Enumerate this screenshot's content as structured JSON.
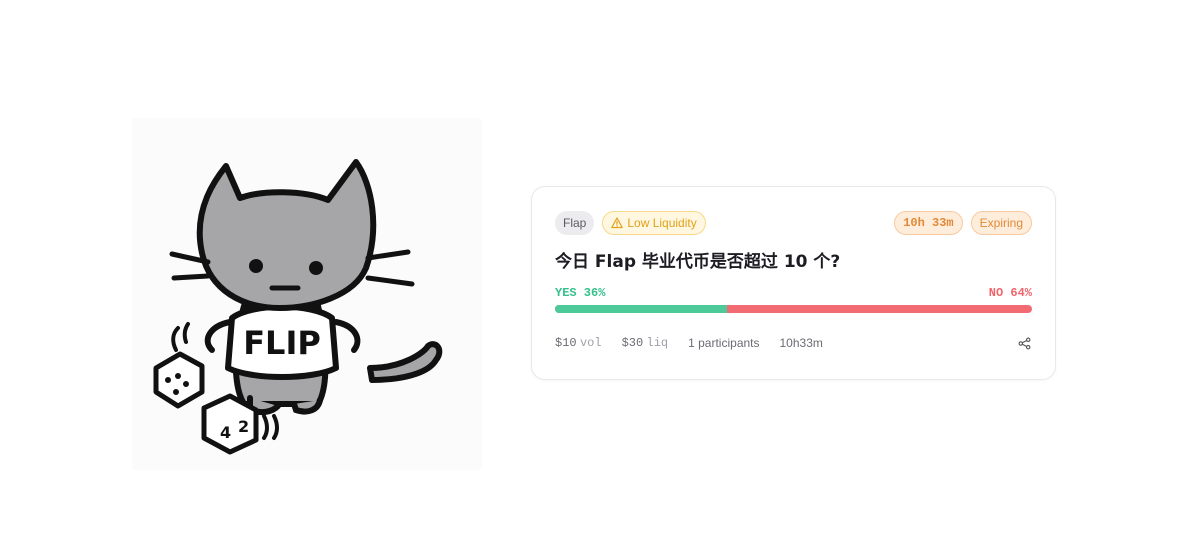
{
  "illustration": {
    "shirt_text": "FLIP",
    "die_face_text": [
      "4",
      "2"
    ]
  },
  "market": {
    "category_tag": "Flap",
    "warning_tag": "Low Liquidity",
    "timer_tag": "10h 33m",
    "status_tag": "Expiring",
    "question": "今日 Flap 毕业代币是否超过 10 个?",
    "yes_label": "YES 36%",
    "no_label": "NO 64%",
    "yes_percent": 36,
    "volume_value": "$10",
    "volume_unit": "vol",
    "liquidity_value": "$30",
    "liquidity_unit": "liq",
    "participants": "1 participants",
    "time_left": "10h33m"
  },
  "colors": {
    "yes": "#4ec99a",
    "no": "#f26b73",
    "warning": "#e2a11a",
    "expiring": "#e08a38"
  },
  "icons": {
    "warning": "warning-triangle-icon",
    "share": "share-icon"
  }
}
